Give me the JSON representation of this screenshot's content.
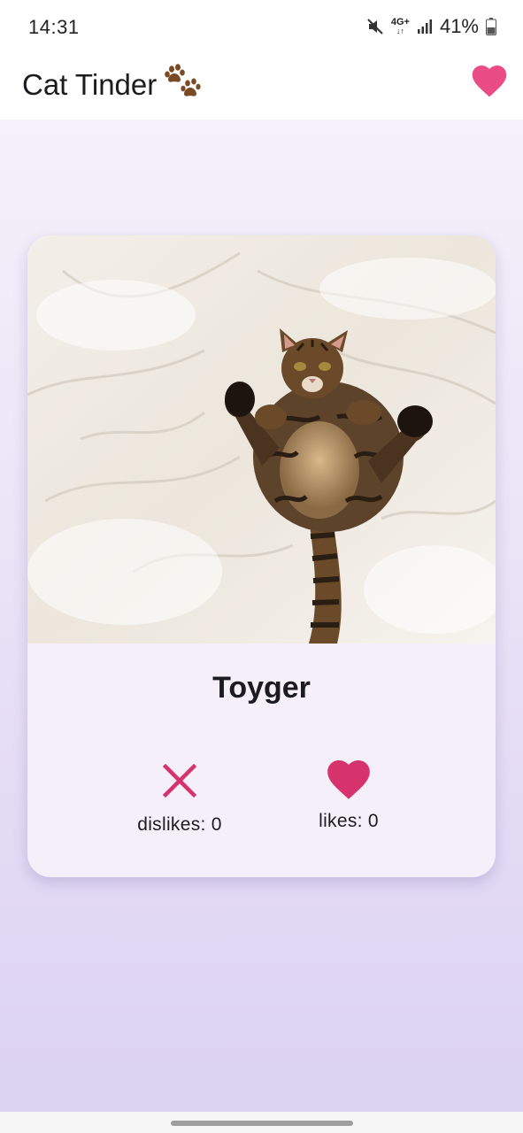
{
  "status_bar": {
    "time": "14:31",
    "network": "4G+",
    "battery": "41%",
    "icons": [
      "mute-icon",
      "network-4g-icon",
      "signal-icon",
      "battery-icon"
    ]
  },
  "app_bar": {
    "title": "Cat Tinder",
    "title_icon": "paw-icon",
    "action_icon": "heart-icon"
  },
  "card": {
    "image_description_icon": "cat-photo",
    "name": "Toyger",
    "dislike": {
      "icon": "close-icon",
      "label": "dislikes: 0"
    },
    "like": {
      "icon": "heart-icon",
      "label": "likes: 0"
    }
  },
  "colors": {
    "accent_pink": "#e0306a",
    "heart_pink": "#ea4d86",
    "background_lavender": "#e8e0f6",
    "card_surface": "#f4eff8"
  }
}
